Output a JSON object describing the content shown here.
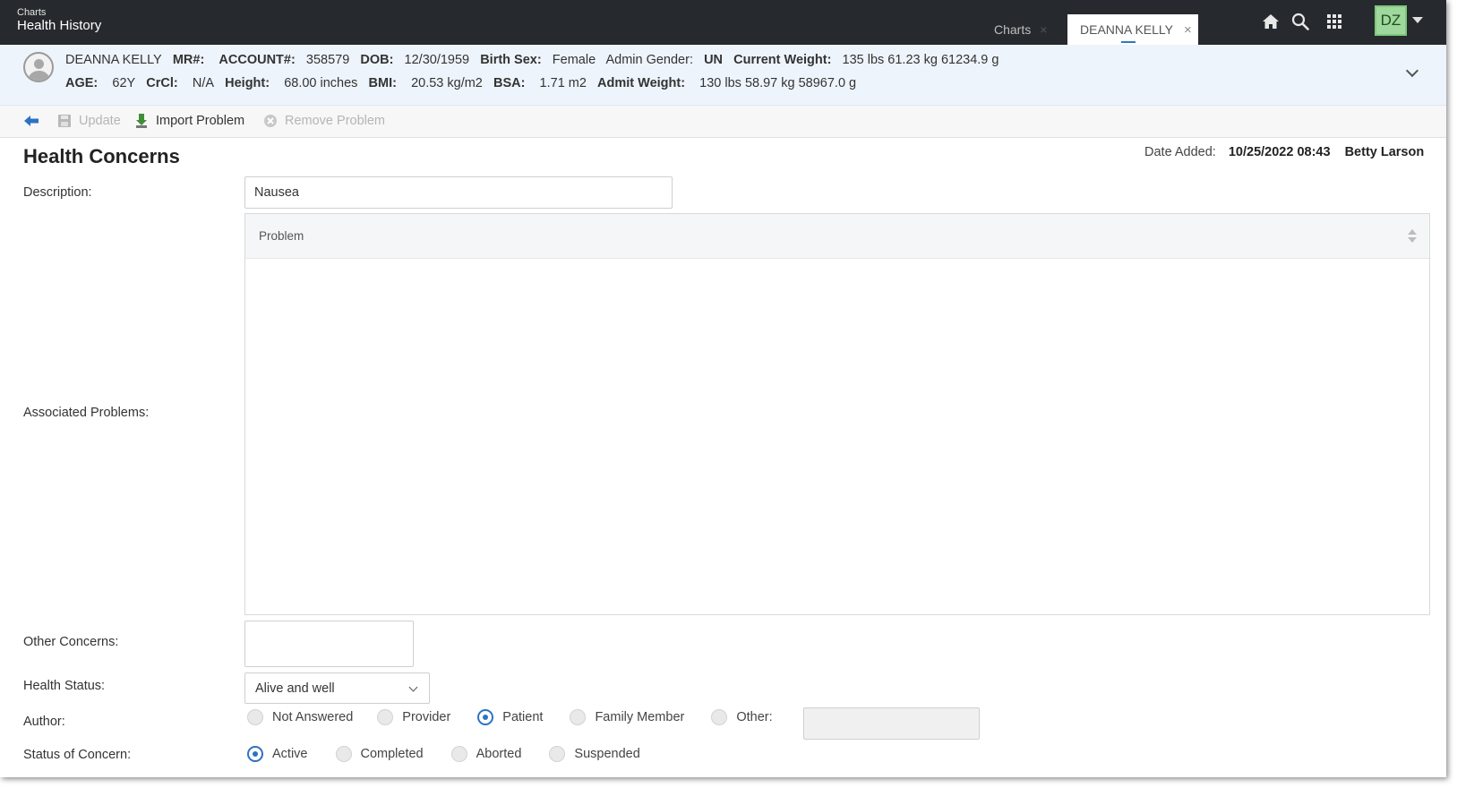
{
  "app": {
    "small_label": "Charts",
    "title": "Health History"
  },
  "tabs": [
    {
      "label": "Charts",
      "close": "×"
    },
    {
      "label": "DEANNA KELLY",
      "close": "×"
    }
  ],
  "user": {
    "initials": "DZ"
  },
  "icons": {
    "home": "home-icon",
    "search": "search-icon",
    "apps": "grid-icon"
  },
  "colors": {
    "accent": "#2d72c4",
    "topbar": "#262a2e",
    "banner": "#eef4fb",
    "avatar": "#9fd89c"
  },
  "patient": {
    "name": "DEANNA KELLY",
    "mr_label": "MR#:",
    "mr_value": "",
    "account_label": "ACCOUNT#:",
    "account_value": "358579",
    "dob_label": "DOB:",
    "dob_value": "12/30/1959",
    "birth_sex_label": "Birth Sex:",
    "birth_sex_value": "Female",
    "admin_gender_label": "Admin Gender:",
    "admin_gender_value": "UN",
    "current_weight_label": "Current Weight:",
    "current_weight_value": "135 lbs 61.23 kg 61234.9 g",
    "age_label": "AGE:",
    "age_value": "62Y",
    "crcl_label": "CrCl:",
    "crcl_value": "N/A",
    "height_label": "Height:",
    "height_value": "68.00 inches",
    "bmi_label": "BMI:",
    "bmi_value": "20.53 kg/m2",
    "bsa_label": "BSA:",
    "bsa_value": "1.71 m2",
    "admit_weight_label": "Admit Weight:",
    "admit_weight_value": "130 lbs 58.97 kg 58967.0 g"
  },
  "toolbar": {
    "update_label": "Update",
    "import_label": "Import Problem",
    "remove_label": "Remove Problem"
  },
  "form": {
    "title": "Health Concerns",
    "date_added_label": "Date Added:",
    "date_added_value": "10/25/2022 08:43",
    "added_by": "Betty Larson",
    "description_label": "Description:",
    "description_value": "Nausea",
    "associated_problems_label": "Associated Problems:",
    "problem_column": "Problem",
    "other_concerns_label": "Other Concerns:",
    "health_status_label": "Health Status:",
    "health_status_value": "Alive and well",
    "author_label": "Author:",
    "author_options": [
      "Not Answered",
      "Provider",
      "Patient",
      "Family Member",
      "Other:"
    ],
    "author_selected": "Patient",
    "status_label": "Status of Concern:",
    "status_options": [
      "Active",
      "Completed",
      "Aborted",
      "Suspended"
    ],
    "status_selected": "Active"
  }
}
